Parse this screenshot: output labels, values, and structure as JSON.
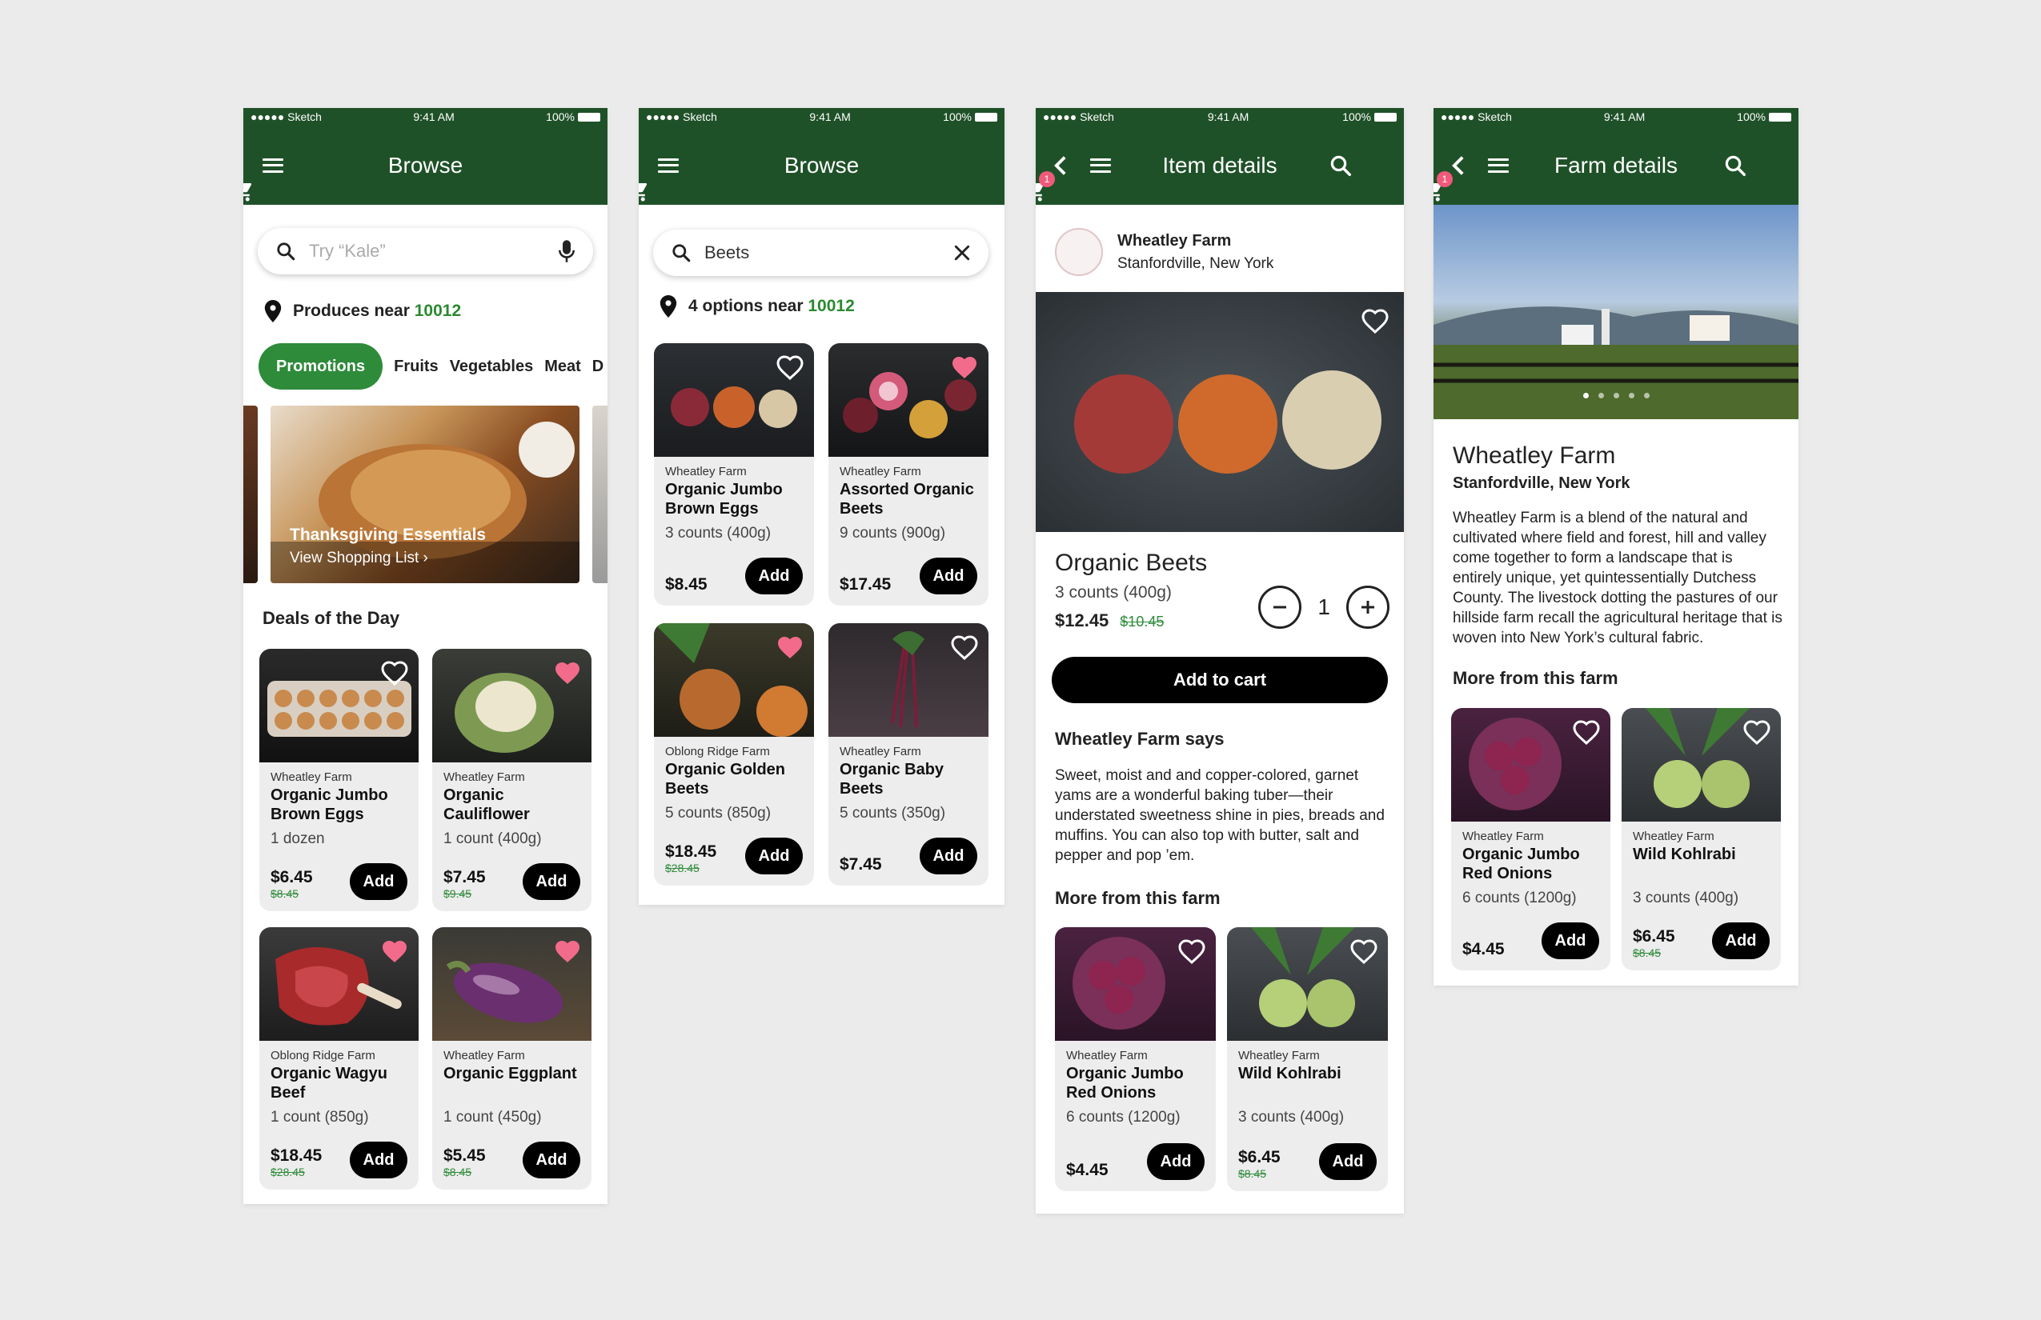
{
  "status": {
    "carrier": "●●●●● Sketch",
    "time": "9:41 AM",
    "battery": "100%"
  },
  "screens": {
    "browse": {
      "title": "Browse",
      "search_placeholder": "Try “Kale”",
      "location_text": "Produces near",
      "zip": "10012",
      "categories": [
        "Promotions",
        "Fruits",
        "Vegetables",
        "Meat",
        "D"
      ],
      "banner": {
        "title": "Thanksgiving Essentials",
        "link": "View Shopping List ›"
      },
      "section": "Deals of the Day",
      "products": [
        {
          "farm": "Wheatley Farm",
          "name": "Organic Jumbo Brown Eggs",
          "count": "1 dozen",
          "price": "$6.45",
          "old": "$8.45",
          "fav": false
        },
        {
          "farm": "Wheatley Farm",
          "name": "Organic Cauliflower",
          "count": "1 count (400g)",
          "price": "$7.45",
          "old": "$9.45",
          "fav": true
        },
        {
          "farm": "Oblong Ridge Farm",
          "name": "Organic Wagyu Beef",
          "count": "1 count (850g)",
          "price": "$18.45",
          "old": "$28.45",
          "fav": true
        },
        {
          "farm": "Wheatley Farm",
          "name": "Organic Eggplant",
          "count": "1 count (450g)",
          "price": "$5.45",
          "old": "$8.45",
          "fav": true
        }
      ]
    },
    "search": {
      "title": "Browse",
      "query": "Beets",
      "location_text": "4 options near",
      "zip": "10012",
      "products": [
        {
          "farm": "Wheatley Farm",
          "name": "Organic Jumbo Brown Eggs",
          "count": "3 counts (400g)",
          "price": "$8.45",
          "old": "",
          "fav": false
        },
        {
          "farm": "Wheatley Farm",
          "name": "Assorted Organic Beets",
          "count": "9 counts (900g)",
          "price": "$17.45",
          "old": "",
          "fav": true
        },
        {
          "farm": "Oblong Ridge Farm",
          "name": "Organic Golden Beets",
          "count": "5 counts (850g)",
          "price": "$18.45",
          "old": "$28.45",
          "fav": true
        },
        {
          "farm": "Wheatley Farm",
          "name": "Organic Baby Beets",
          "count": "5 counts (350g)",
          "price": "$7.45",
          "old": "",
          "fav": false
        }
      ]
    },
    "item": {
      "title": "Item details",
      "cart_count": "1",
      "farm_name": "Wheatley Farm",
      "farm_location": "Stanfordville, New York",
      "product_name": "Organic Beets",
      "count": "3 counts (400g)",
      "price": "$12.45",
      "old_price": "$10.45",
      "quantity": "1",
      "add_to_cart": "Add to cart",
      "says_title": "Wheatley Farm says",
      "description": "Sweet, moist and and copper-colored, garnet yams are a wonderful baking tuber—their understated sweetness shine in pies, breads and muffins. You can also top with butter, salt and pepper and pop ’em.",
      "more_title": "More from this farm",
      "products": [
        {
          "farm": "Wheatley Farm",
          "name": "Organic Jumbo Red Onions",
          "count": "6 counts (1200g)",
          "price": "$4.45",
          "old": "",
          "fav": false
        },
        {
          "farm": "Wheatley Farm",
          "name": "Wild Kohlrabi",
          "count": "3 counts (400g)",
          "price": "$6.45",
          "old": "$8.45",
          "fav": false
        }
      ]
    },
    "farm": {
      "title": "Farm details",
      "cart_count": "1",
      "name": "Wheatley Farm",
      "location": "Stanfordville, New York",
      "description": "Wheatley Farm is a blend of the natural and cultivated where field and forest, hill and valley come together to form a landscape that is entirely unique, yet quintessentially Dutchess County. The livestock dotting the pastures of our hillside farm recall the agricultural heritage that is woven into New York’s cultural fabric.",
      "more_title": "More from this farm",
      "products": [
        {
          "farm": "Wheatley Farm",
          "name": "Organic Jumbo Red Onions",
          "count": "6 counts (1200g)",
          "price": "$4.45",
          "old": "",
          "fav": false
        },
        {
          "farm": "Wheatley Farm",
          "name": "Wild Kohlrabi",
          "count": "3 counts (400g)",
          "price": "$6.45",
          "old": "$8.45",
          "fav": false
        }
      ]
    }
  },
  "add_label": "Add",
  "colors": {
    "header": "#1f5128",
    "accent": "#2e8b3a",
    "heart": "#f26b8a"
  }
}
